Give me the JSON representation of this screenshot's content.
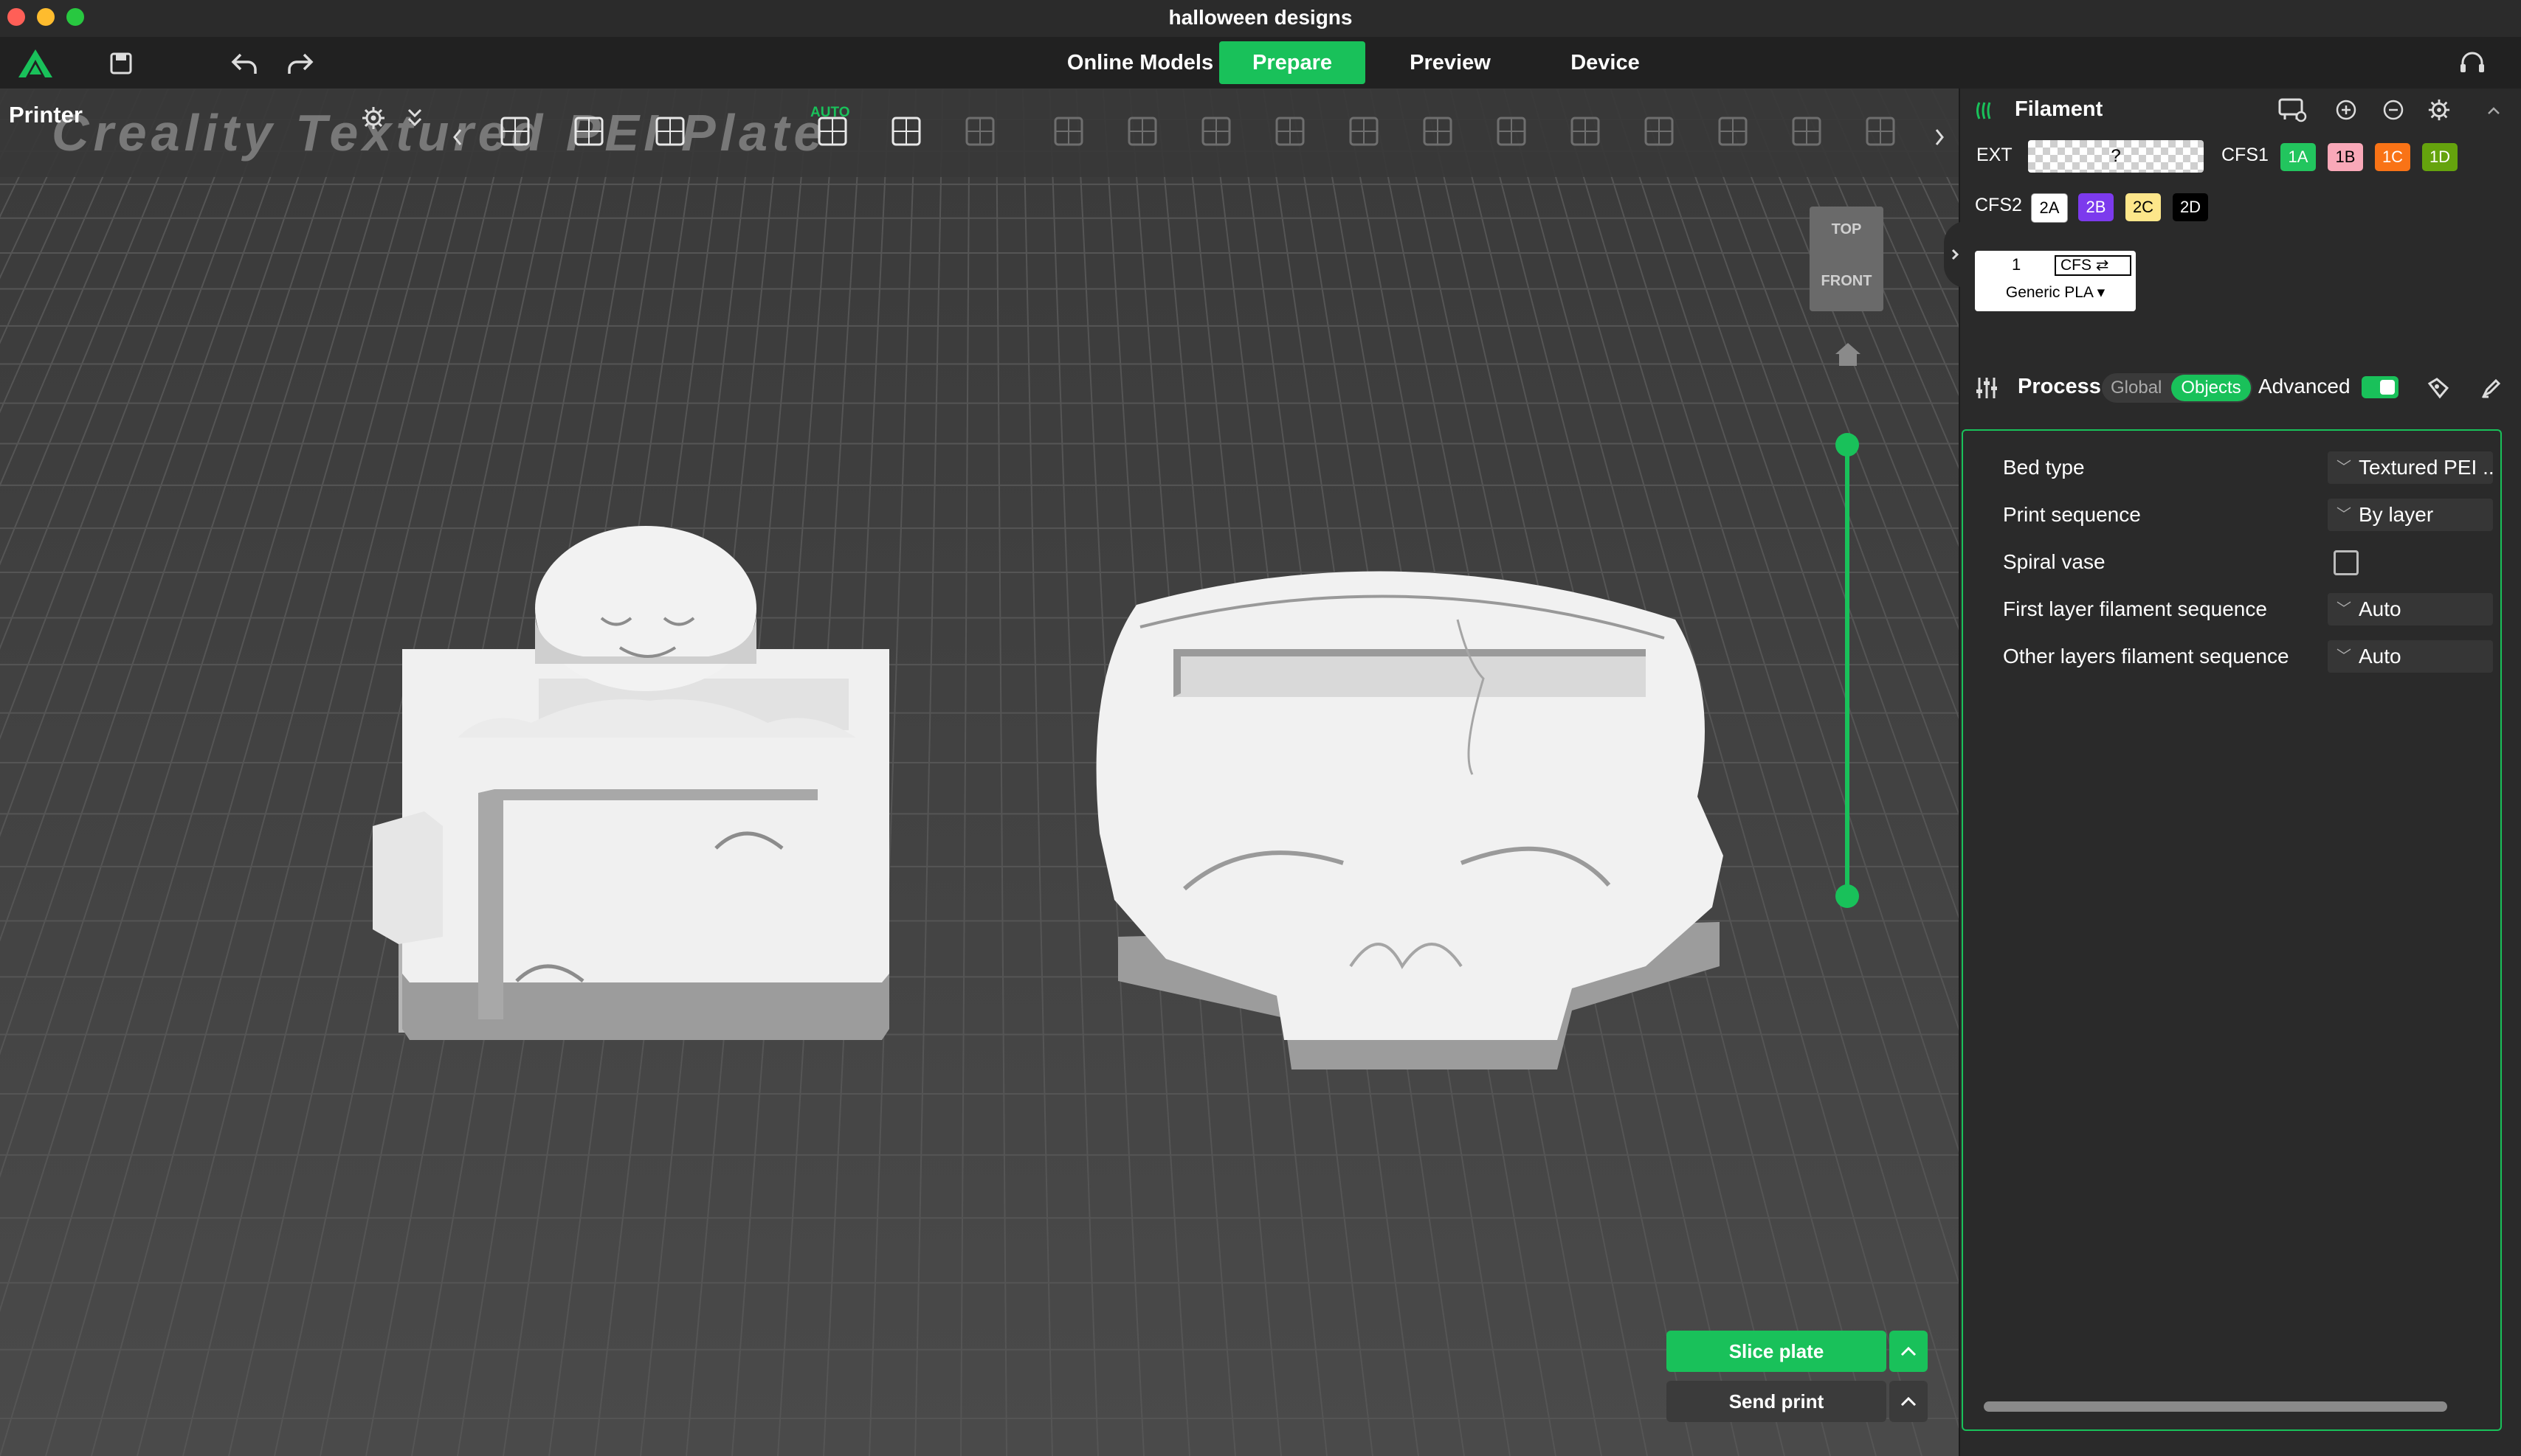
{
  "window": {
    "title": "halloween designs"
  },
  "nav": {
    "tabs": [
      "Online Models",
      "Prepare",
      "Preview",
      "Device"
    ],
    "active": "Prepare"
  },
  "viewport": {
    "printer_label": "Printer",
    "plate_name": "Creality Textured PEI Plate",
    "auto_label": "AUTO",
    "cube_top": "TOP",
    "cube_front": "FRONT"
  },
  "actions": {
    "slice": "Slice plate",
    "send": "Send print"
  },
  "filament": {
    "title": "Filament",
    "ext_label": "EXT",
    "ext_value": "?",
    "cfs1_label": "CFS1",
    "cfs1_slots": [
      {
        "label": "1A",
        "color": "#22c55e"
      },
      {
        "label": "1B",
        "color": "#f9a8b8"
      },
      {
        "label": "1C",
        "color": "#f97316"
      },
      {
        "label": "1D",
        "color": "#65a30d"
      }
    ],
    "cfs2_label": "CFS2",
    "cfs2_slots": [
      {
        "label": "2A",
        "color": "#ffffff"
      },
      {
        "label": "2B",
        "color": "#7c3aed"
      },
      {
        "label": "2C",
        "color": "#fde68a"
      },
      {
        "label": "2D",
        "color": "#000000"
      }
    ],
    "slot_number": "1",
    "slot_source": "CFS ⇄",
    "slot_material": "Generic PLA ▾"
  },
  "process": {
    "title": "Process",
    "global": "Global",
    "objects": "Objects",
    "advanced": "Advanced",
    "rows": [
      {
        "label": "Bed type",
        "value": "Textured PEI .."
      },
      {
        "label": "Print sequence",
        "value": "By layer"
      },
      {
        "label": "Spiral vase",
        "value": ""
      },
      {
        "label": "First layer filament sequence",
        "value": "Auto"
      },
      {
        "label": "Other layers filament sequence",
        "value": "Auto"
      }
    ]
  }
}
